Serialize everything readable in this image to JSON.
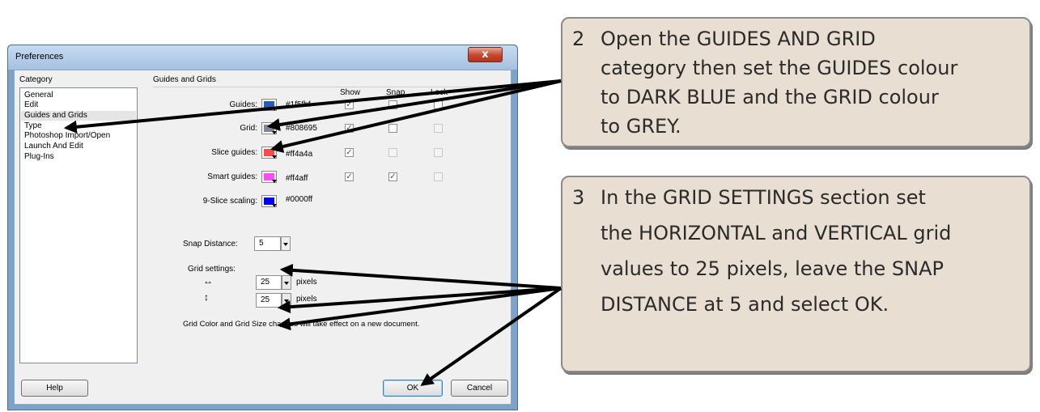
{
  "window": {
    "title": "Preferences",
    "close_symbol": "x"
  },
  "category": {
    "label": "Category",
    "items": [
      "General",
      "Edit",
      "Guides and Grids",
      "Type",
      "Photoshop Import/Open",
      "Launch And Edit",
      "Plug-Ins"
    ],
    "selected": "Guides and Grids"
  },
  "panel": {
    "title": "Guides and Grids",
    "columns": [
      "Show",
      "Snap",
      "Lock"
    ],
    "rows": [
      {
        "label": "Guides:",
        "color": "#1f5fbf",
        "hex": "#1f5fbf",
        "show": true,
        "snap": false,
        "lock": false
      },
      {
        "label": "Grid:",
        "color": "#808695",
        "hex": "#808695",
        "show": true,
        "snap": false,
        "lock": null
      },
      {
        "label": "Slice guides:",
        "color": "#ff4a4a",
        "hex": "#ff4a4a",
        "show": true,
        "snap": null,
        "lock": null
      },
      {
        "label": "Smart guides:",
        "color": "#ff4aff",
        "hex": "#ff4aff",
        "show": true,
        "snap": true,
        "lock": null
      }
    ],
    "nine_slice": {
      "label": "9-Slice scaling:",
      "color": "#0000ff",
      "hex": "#0000ff"
    },
    "snap_distance": {
      "label": "Snap Distance:",
      "value": "5"
    },
    "grid_settings": {
      "label": "Grid settings:",
      "horizontal": {
        "symbol": "↔",
        "value": "25",
        "unit": "pixels"
      },
      "vertical": {
        "symbol": "↕",
        "value": "25",
        "unit": "pixels"
      }
    },
    "note": "Grid Color and Grid Size changes will take effect on a new document."
  },
  "buttons": {
    "help": "Help",
    "ok": "OK",
    "cancel": "Cancel"
  },
  "callouts": [
    {
      "number": "2",
      "lines": [
        "Open the GUIDES AND GRID",
        "category then set the GUIDES colour",
        "to DARK BLUE and the GRID colour",
        "to GREY."
      ]
    },
    {
      "number": "3",
      "lines": [
        "In the GRID SETTINGS section set",
        "the HORIZONTAL and VERTICAL grid",
        "values to 25 pixels, leave the SNAP",
        "DISTANCE at 5 and select OK."
      ]
    }
  ]
}
